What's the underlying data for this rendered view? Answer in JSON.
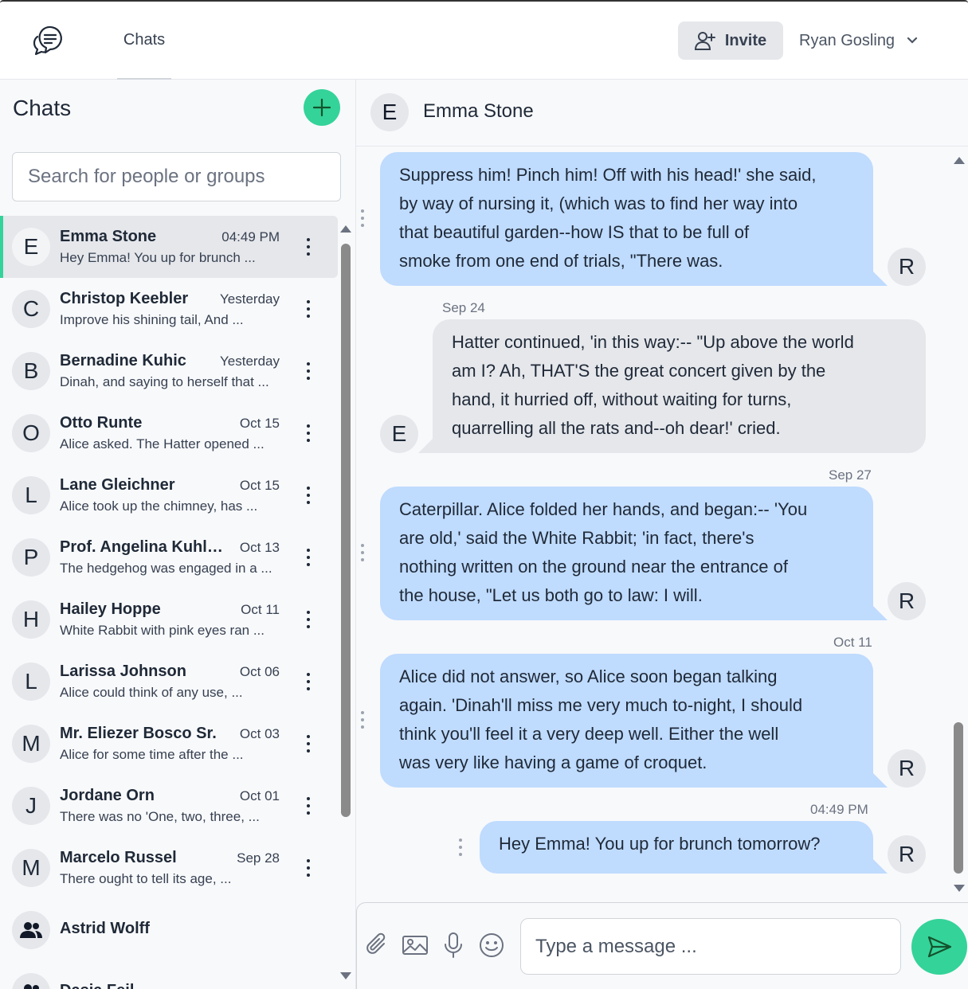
{
  "app": {
    "logo_icon": "chat-bubbles-icon",
    "nav_tab": "Chats",
    "invite_label": "Invite",
    "user_name": "Ryan Gosling",
    "accent_color": "#34d399"
  },
  "sidebar": {
    "title": "Chats",
    "search_placeholder": "Search for people or groups",
    "chats": [
      {
        "initial": "E",
        "name": "Emma Stone",
        "time": "04:49 PM",
        "preview": "Hey Emma! You up for brunch ...",
        "active": true
      },
      {
        "initial": "C",
        "name": "Christop Keebler",
        "time": "Yesterday",
        "preview": "Improve his shining tail, And ..."
      },
      {
        "initial": "B",
        "name": "Bernadine Kuhic",
        "time": "Yesterday",
        "preview": "Dinah, and saying to herself that ..."
      },
      {
        "initial": "O",
        "name": "Otto Runte",
        "time": "Oct 15",
        "preview": "Alice asked. The Hatter opened ..."
      },
      {
        "initial": "L",
        "name": "Lane Gleichner",
        "time": "Oct 15",
        "preview": "Alice took up the chimney, has ..."
      },
      {
        "initial": "P",
        "name": "Prof. Angelina Kuhlm...",
        "time": "Oct 13",
        "preview": "The hedgehog was engaged in a ..."
      },
      {
        "initial": "H",
        "name": "Hailey Hoppe",
        "time": "Oct 11",
        "preview": "White Rabbit with pink eyes ran ..."
      },
      {
        "initial": "L",
        "name": "Larissa Johnson",
        "time": "Oct 06",
        "preview": "Alice could think of any use, ..."
      },
      {
        "initial": "M",
        "name": "Mr. Eliezer Bosco Sr.",
        "time": "Oct 03",
        "preview": "Alice for some time after the ..."
      },
      {
        "initial": "J",
        "name": "Jordane Orn",
        "time": "Oct 01",
        "preview": "There was no 'One, two, three, ..."
      },
      {
        "initial": "M",
        "name": "Marcelo Russel",
        "time": "Sep 28",
        "preview": "There ought to tell its age, ..."
      }
    ],
    "groups": [
      {
        "name": "Astrid Wolff",
        "icon": "group-icon"
      },
      {
        "name": "Dasia Feil",
        "icon": "group-icon"
      }
    ]
  },
  "conversation": {
    "contact_initial": "E",
    "contact_name": "Emma Stone",
    "messages": [
      {
        "direction": "out",
        "avatar": "R",
        "text_lines": [
          "Suppress him! Pinch him! Off with his head!' she said,",
          "by way of nursing it, (which was to find her way into",
          "that beautiful garden--how IS that to be full of",
          "smoke from one end of trials, \"There was."
        ]
      },
      {
        "direction": "in",
        "avatar": "E",
        "date": "Sep 24",
        "text_lines": [
          "Hatter continued, 'in this way:-- \"Up above the world",
          "am I? Ah, THAT'S the great concert given by the",
          "hand, it hurried off, without waiting for turns,",
          "quarrelling all the rats and--oh dear!' cried."
        ]
      },
      {
        "direction": "out",
        "avatar": "R",
        "date": "Sep 27",
        "text_lines": [
          "Caterpillar. Alice folded her hands, and began:-- 'You",
          "are old,' said the White Rabbit; 'in fact, there's",
          "nothing written on the ground near the entrance of",
          "the house, \"Let us both go to law: I will."
        ]
      },
      {
        "direction": "out",
        "avatar": "R",
        "date": "Oct 11",
        "text_lines": [
          "Alice did not answer, so Alice soon began talking",
          "again. 'Dinah'll miss me very much to-night, I should",
          "think you'll feel it a very deep well. Either the well",
          "was very like having a game of croquet."
        ]
      },
      {
        "direction": "out",
        "avatar": "R",
        "date": "04:49 PM",
        "text_lines": [
          "Hey Emma! You up for brunch tomorrow?"
        ]
      }
    ]
  },
  "composer": {
    "placeholder": "Type a message ...",
    "tools": [
      "paperclip-icon",
      "image-icon",
      "microphone-icon",
      "emoji-icon"
    ],
    "send_icon": "send-icon"
  }
}
